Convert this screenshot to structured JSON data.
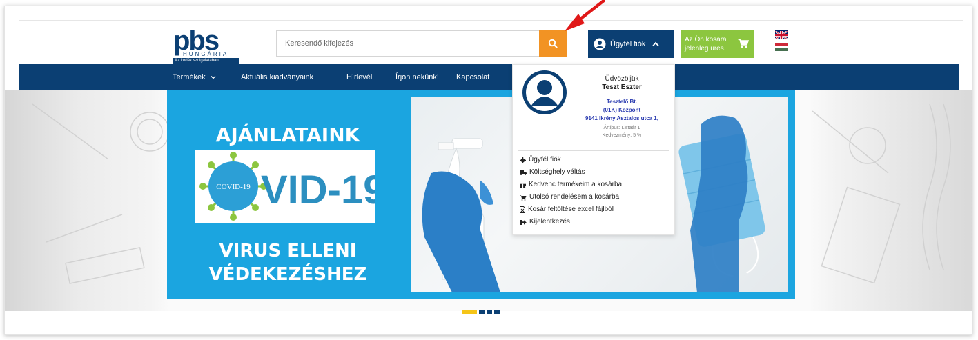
{
  "header": {
    "logo_text": "pbs",
    "logo_sub": "HUNGÁRIA",
    "logo_tagline": "Az irodák szolgálatában",
    "search_placeholder": "Keresendő kifejezés",
    "account_label": "Ügyfél fiók",
    "cart_line1": "Az Ön kosara",
    "cart_line2": "jelenleg üres."
  },
  "nav": {
    "items": [
      {
        "label": "Termékek"
      },
      {
        "label": "Aktuális kiadványaink"
      },
      {
        "label": "Hírlevél"
      },
      {
        "label": "Írjon nekünk!"
      },
      {
        "label": "Kapcsolat"
      }
    ]
  },
  "dropdown": {
    "welcome": "Üdvözöljük",
    "name": "Teszt Eszter",
    "company": "Tesztelő Bt.",
    "branch": "(01K) Központ",
    "address": "9141 Ikrény Asztalos utca 1,",
    "price_type": "Ártípus: Listaár 1",
    "discount": "Kedvezmény: 5 %",
    "menu": [
      {
        "label": "Ügyfél fiók",
        "icon": "gear-icon"
      },
      {
        "label": "Költséghely váltás",
        "icon": "truck-icon"
      },
      {
        "label": "Kedvenc termékeim a kosárba",
        "icon": "gift-icon"
      },
      {
        "label": "Utolsó rendelésem a kosárba",
        "icon": "cart-icon"
      },
      {
        "label": "Kosár feltöltése excel fájlból",
        "icon": "file-icon"
      },
      {
        "label": "Kijelentkezés",
        "icon": "logout-icon"
      }
    ]
  },
  "hero": {
    "title": "AJÁNLATAINK",
    "covid_small": "COVID-19",
    "covid_big": "VID-19",
    "line1": "VIRUS ELLENI",
    "line2": "VÉDEKEZÉSHEZ"
  },
  "colors": {
    "brand_blue": "#0b3f73",
    "search_orange": "#f29324",
    "cart_green": "#8cc63f",
    "hero_blue": "#1ba5e0",
    "dot_yellow": "#f5c518"
  }
}
